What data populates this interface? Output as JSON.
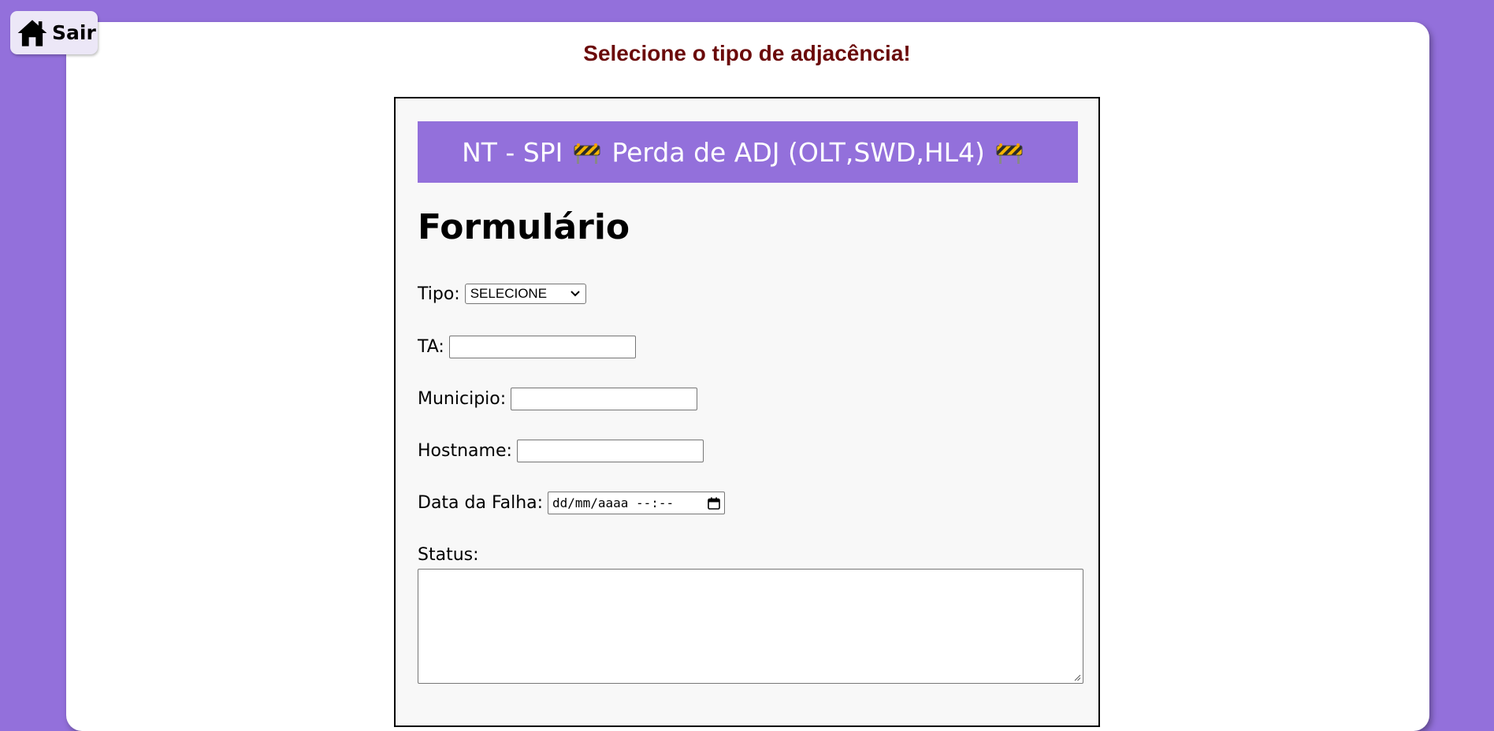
{
  "nav": {
    "exit_label": "Sair",
    "exit_icon": "home-icon"
  },
  "page": {
    "heading": "Selecione o tipo de adjacência!"
  },
  "banner": {
    "text": "NT - SPI",
    "text2": "Perda de ADJ (OLT,SWD,HL4)",
    "icon": "construction-barrier-icon"
  },
  "form": {
    "title": "Formulário",
    "tipo_label": "Tipo:",
    "tipo_selected": "SELECIONE",
    "ta_label": "TA:",
    "ta_value": "",
    "municipio_label": "Municipio:",
    "municipio_value": "",
    "hostname_label": "Hostname:",
    "hostname_value": "",
    "data_label": "Data da Falha:",
    "data_placeholder": "dd/mm/aaaa --:--",
    "status_label": "Status:",
    "status_value": ""
  },
  "colors": {
    "background": "#9370db",
    "banner": "#9370db",
    "heading": "#6b0a0a"
  }
}
